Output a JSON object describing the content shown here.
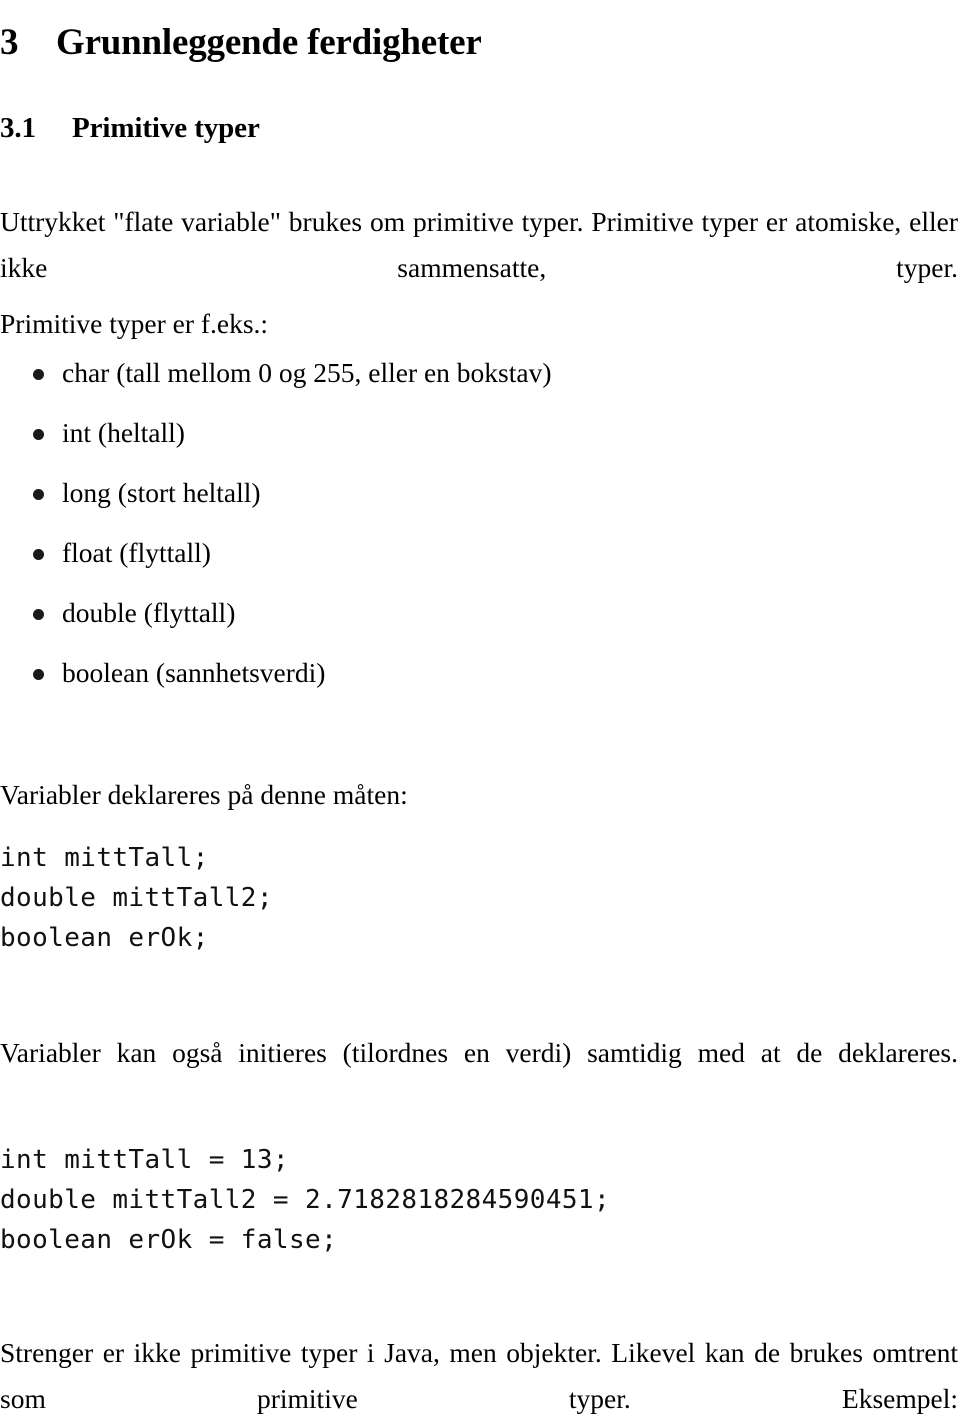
{
  "document": {
    "language": "Norwegian",
    "section": {
      "number": "3",
      "title": "Grunnleggende ferdigheter"
    },
    "subsection": {
      "number": "3.1",
      "title": "Primitive typer"
    },
    "paragraphs": {
      "intro": "Uttrykket \"flate variable\" brukes om primitive typer.  Primitive typer er atomiske, eller ikke sammensatte, typer.",
      "examples_lead": "Primitive typer er f.eks.:",
      "declare_lead": "Variabler deklareres på denne måten:",
      "initialize": "Variabler kan også initieres (tilordnes en verdi) samtidig med at de deklareres.",
      "strings": "Strenger er ikke primitive typer i Java, men objekter.  Likevel kan de brukes omtrent som primitive typer. Eksempel:"
    },
    "primitive_types": [
      {
        "name": "char",
        "description": "(tall mellom 0 og 255, eller en bokstav)",
        "label": "char (tall mellom 0 og 255, eller en bokstav)"
      },
      {
        "name": "int",
        "description": "(heltall)",
        "label": "int (heltall)"
      },
      {
        "name": "long",
        "description": "(stort heltall)",
        "label": "long (stort heltall)"
      },
      {
        "name": "float",
        "description": "(flyttall)",
        "label": "float (flyttall)"
      },
      {
        "name": "double",
        "description": "(flyttall)",
        "label": "double (flyttall)"
      },
      {
        "name": "boolean",
        "description": "(sannhetsverdi)",
        "label": "boolean (sannhetsverdi)"
      }
    ],
    "code_declaration": "int mittTall;\ndouble mittTall2;\nboolean erOk;",
    "code_initialization": "int mittTall = 13;\ndouble mittTall2 = 2.7182818284590451;\nboolean erOk = false;",
    "colors": {
      "page_background": "#ffffff",
      "text": "#000000",
      "bullet": "#1a1a1a"
    }
  }
}
